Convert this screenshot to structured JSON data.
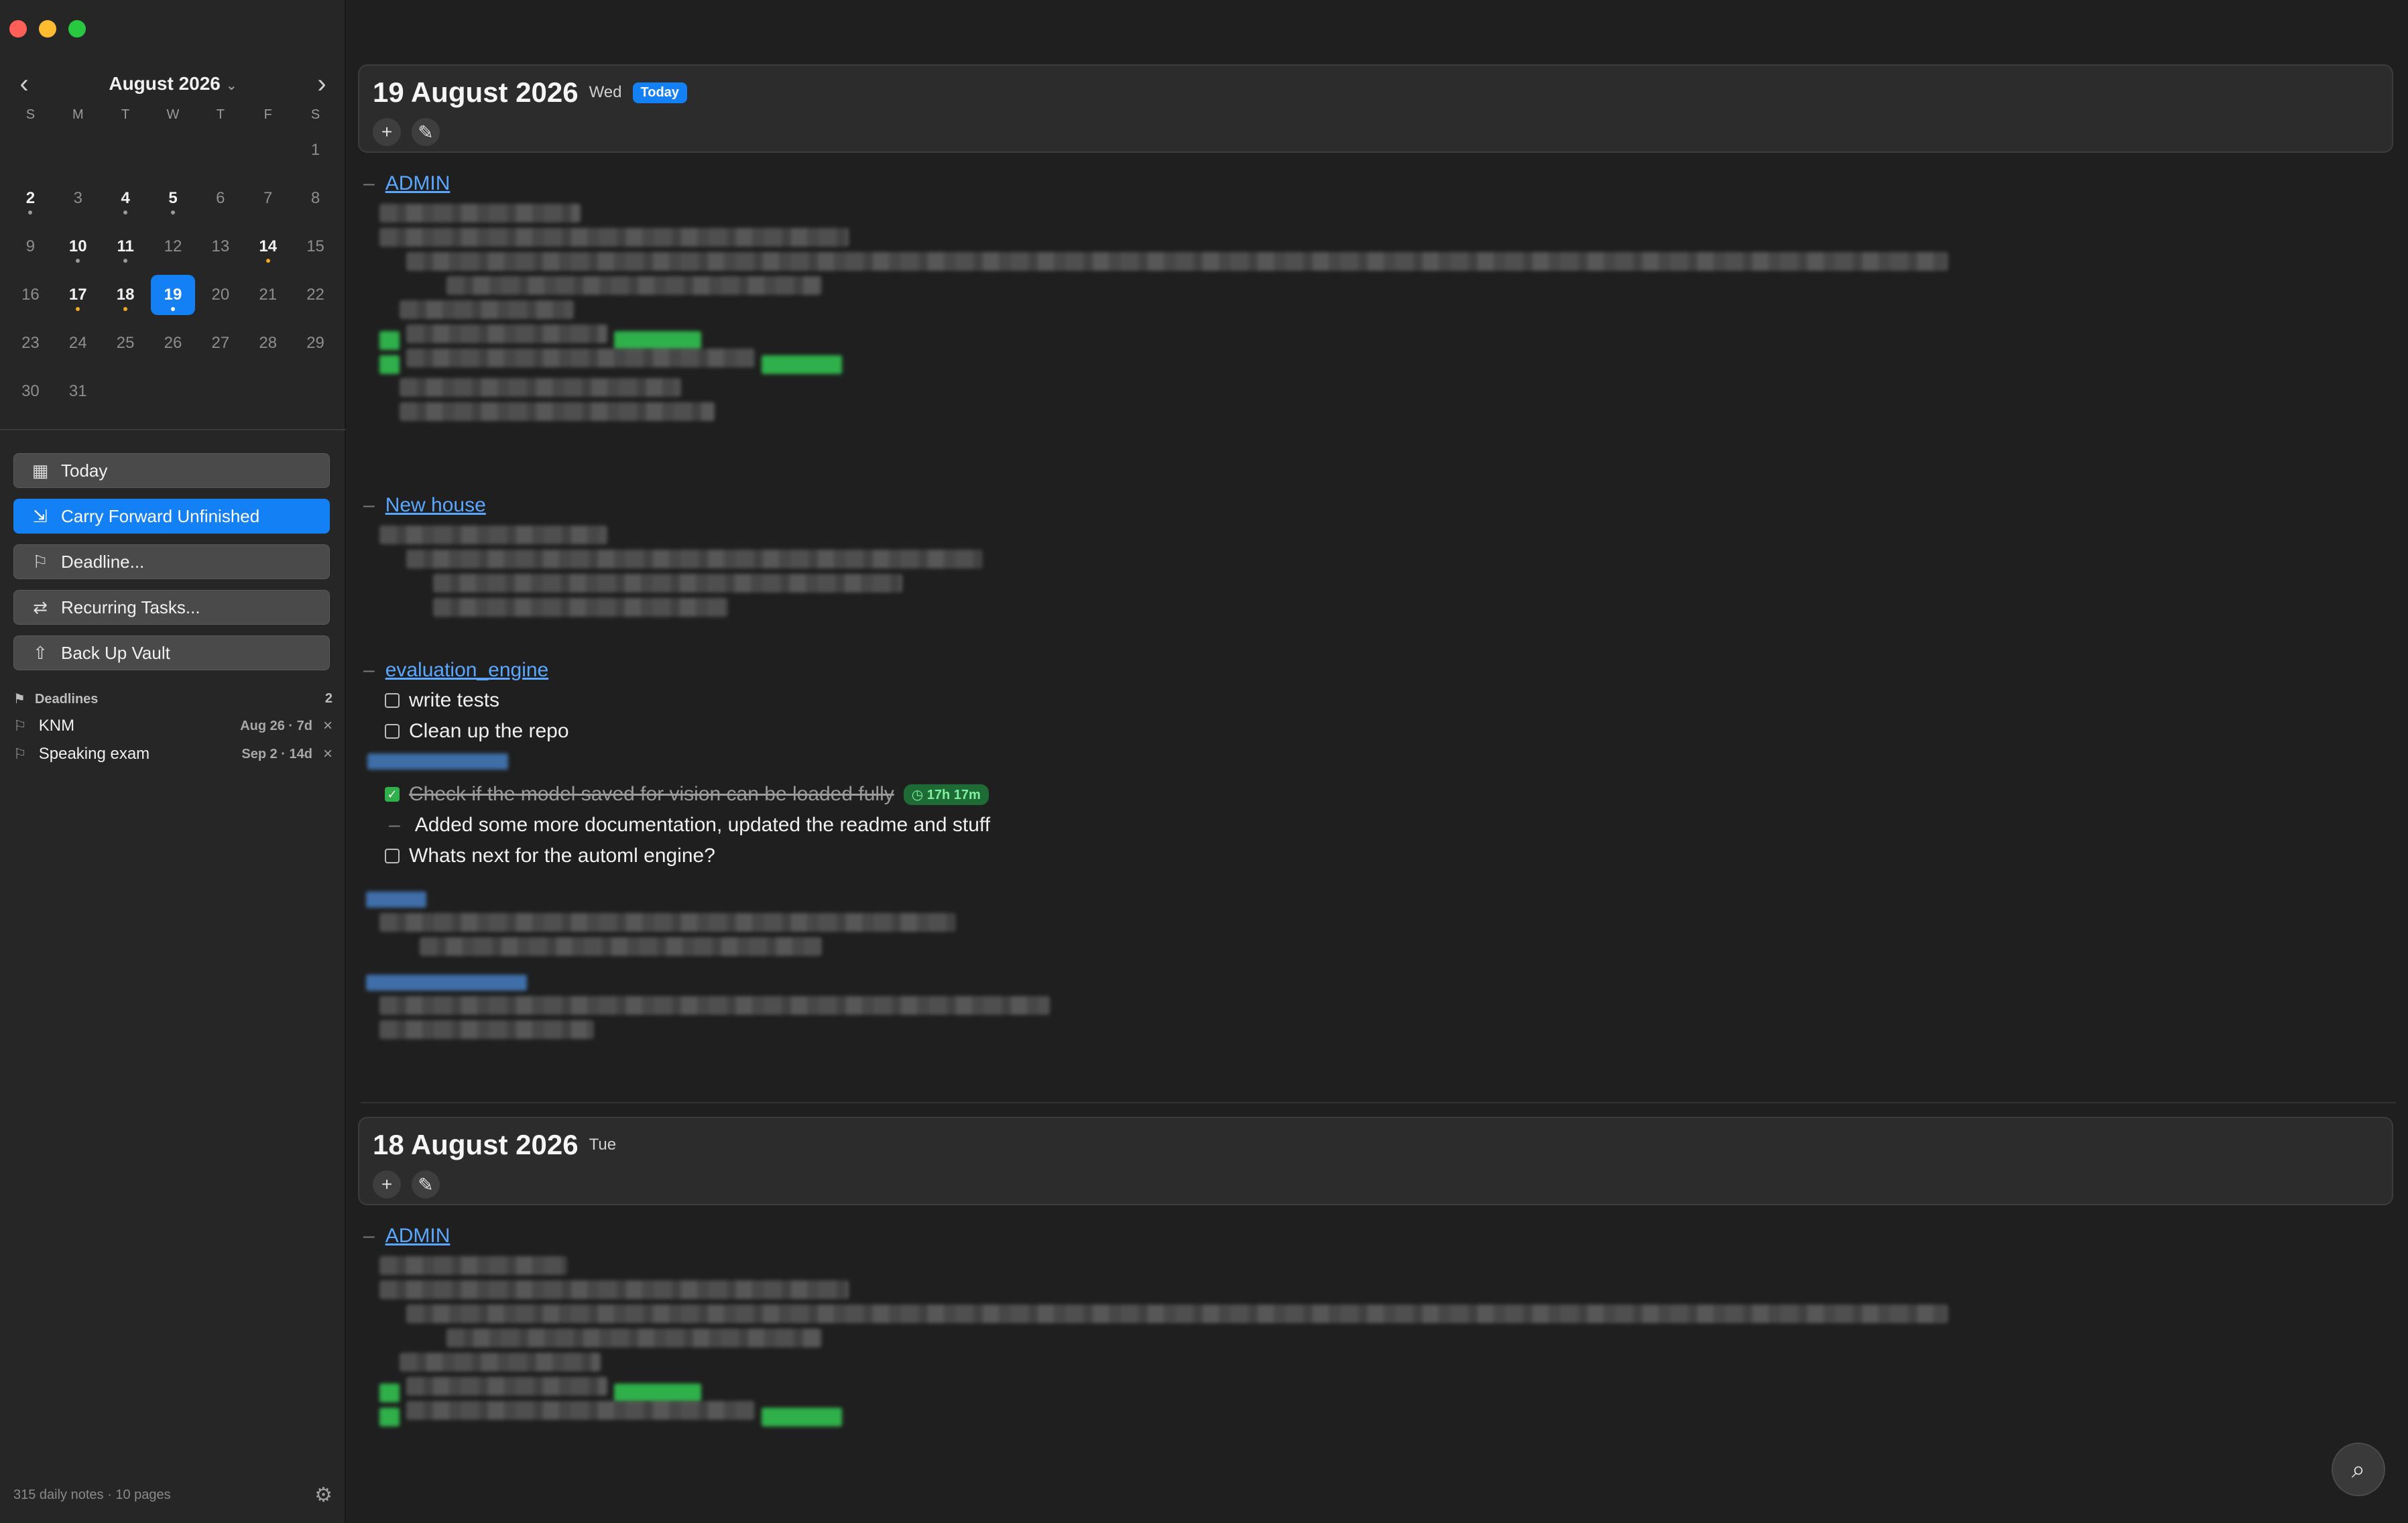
{
  "calendar": {
    "month_label": "August 2026",
    "prev": "‹",
    "next": "›",
    "weekdays": [
      "S",
      "M",
      "T",
      "W",
      "T",
      "F",
      "S"
    ],
    "weeks": [
      [
        "",
        "",
        "",
        "",
        "",
        "",
        "1"
      ],
      [
        "2",
        "3",
        "4",
        "5",
        "6",
        "7",
        "8"
      ],
      [
        "9",
        "10",
        "11",
        "12",
        "13",
        "14",
        "15"
      ],
      [
        "16",
        "17",
        "18",
        "19",
        "20",
        "21",
        "22"
      ],
      [
        "23",
        "24",
        "25",
        "26",
        "27",
        "28",
        "29"
      ],
      [
        "30",
        "31",
        "",
        "",
        "",
        "",
        ""
      ]
    ],
    "has_notes": [
      "2",
      "4",
      "5",
      "10",
      "11",
      "14",
      "17",
      "18",
      "19"
    ],
    "orange_dots": [
      "14",
      "17",
      "18"
    ],
    "gray_dots": [
      "2",
      "4",
      "5",
      "10",
      "11"
    ],
    "selected": "19",
    "colors": {
      "accent": "#1380f5",
      "orange": "#f5a623"
    }
  },
  "actions": {
    "today": "Today",
    "carry_forward": "Carry Forward Unfinished",
    "deadline": "Deadline...",
    "recurring": "Recurring Tasks...",
    "backup": "Back Up Vault"
  },
  "deadlines": {
    "header": "Deadlines",
    "count": "2",
    "items": [
      {
        "name": "KNM",
        "meta": "Aug 26 · 7d"
      },
      {
        "name": "Speaking exam",
        "meta": "Sep 2 · 14d"
      }
    ]
  },
  "footer": {
    "stats": "315 daily notes · 10 pages"
  },
  "days": [
    {
      "title": "19 August 2026",
      "dow": "Wed",
      "badge": "Today",
      "sections": {
        "admin": "ADMIN",
        "new_house": "New house",
        "evaluation": "evaluation_engine"
      },
      "tasks": {
        "write_tests": "write tests",
        "clean_repo": "Clean up the repo",
        "check_model": "Check if the model saved for vision can be loaded fully",
        "check_model_time": "17h 17m",
        "added_docs": "Added some more documentation, updated the readme and stuff",
        "whats_next": "Whats next for the automl engine?"
      }
    },
    {
      "title": "18 August 2026",
      "dow": "Tue",
      "sections": {
        "admin": "ADMIN"
      }
    }
  ],
  "icons": {
    "plus": "+",
    "edit": "✎",
    "search": "⌕",
    "flag": "⚐",
    "close": "×",
    "gear": "⚙"
  }
}
